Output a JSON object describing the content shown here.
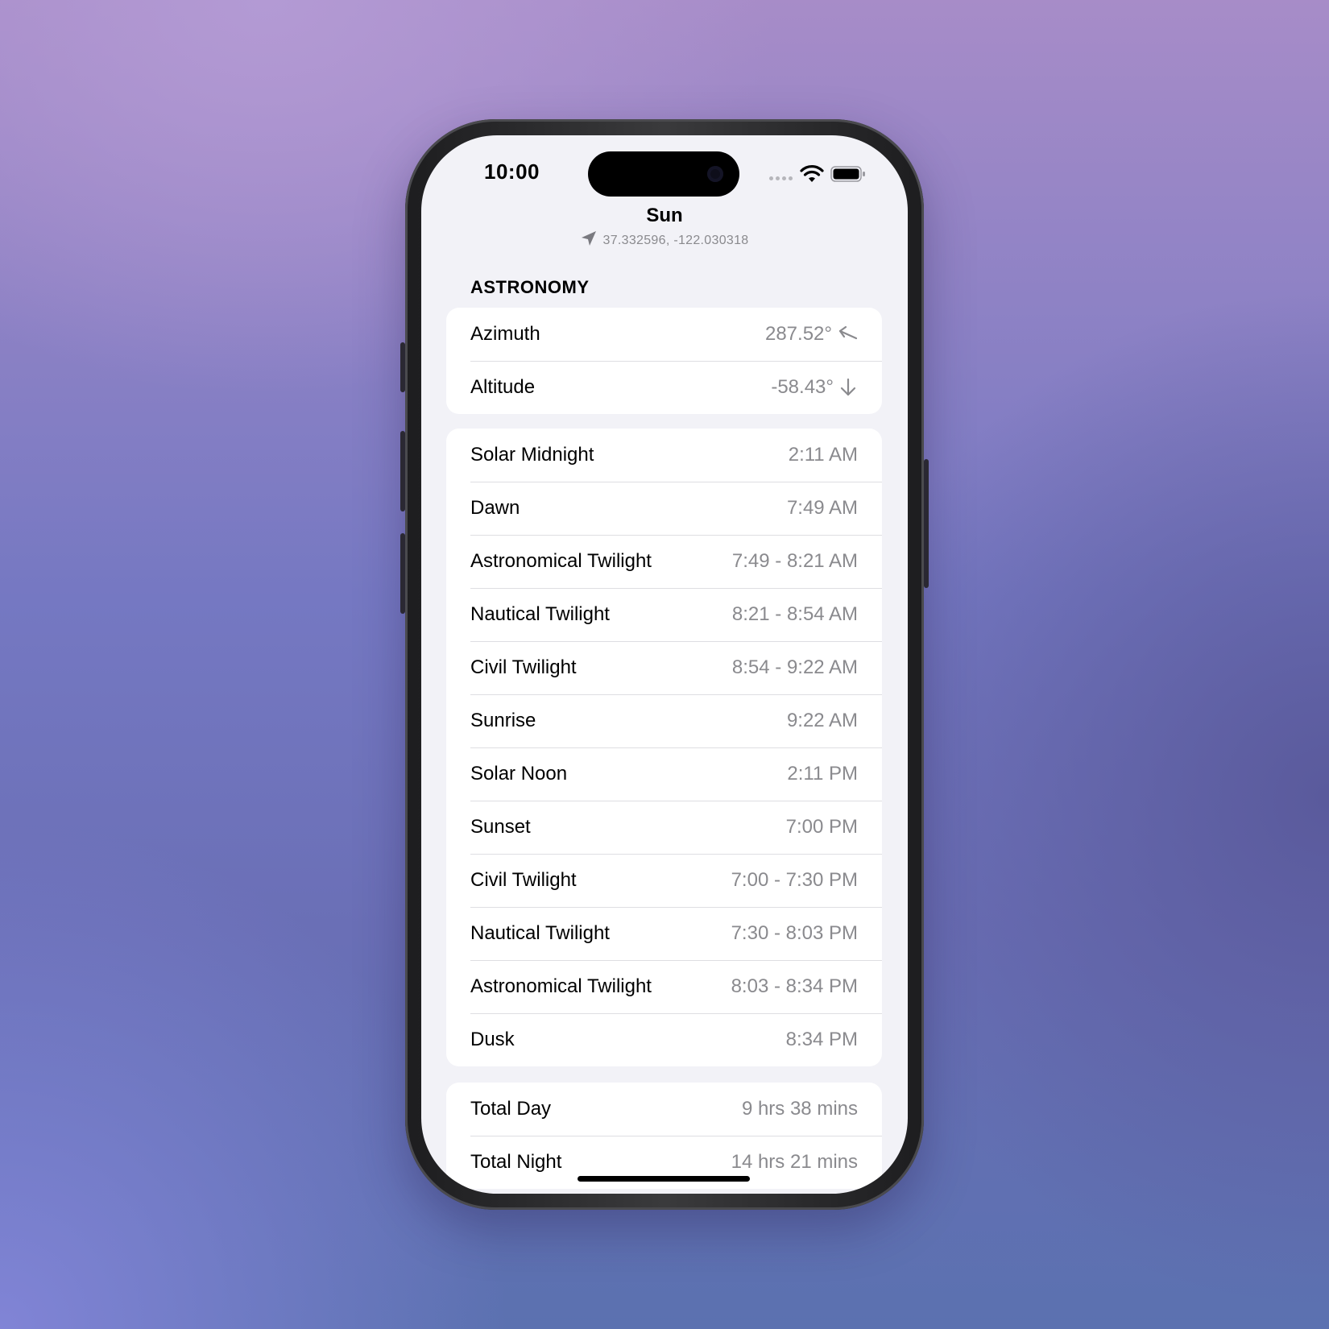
{
  "status_bar": {
    "time": "10:00"
  },
  "header": {
    "title": "Sun",
    "coordinates": "37.332596, -122.030318"
  },
  "section_title": "ASTRONOMY",
  "position_group": [
    {
      "label": "Azimuth",
      "value": "287.52°",
      "icon": "arrow-up-left-icon"
    },
    {
      "label": "Altitude",
      "value": "-58.43°",
      "icon": "arrow-down-icon"
    }
  ],
  "times_group": [
    {
      "label": "Solar Midnight",
      "value": "2:11 AM"
    },
    {
      "label": "Dawn",
      "value": "7:49 AM"
    },
    {
      "label": "Astronomical Twilight",
      "value": "7:49 - 8:21 AM"
    },
    {
      "label": "Nautical Twilight",
      "value": "8:21 - 8:54 AM"
    },
    {
      "label": "Civil Twilight",
      "value": "8:54 - 9:22 AM"
    },
    {
      "label": "Sunrise",
      "value": "9:22 AM"
    },
    {
      "label": "Solar Noon",
      "value": "2:11 PM"
    },
    {
      "label": "Sunset",
      "value": "7:00 PM"
    },
    {
      "label": "Civil Twilight",
      "value": "7:00 - 7:30 PM"
    },
    {
      "label": "Nautical Twilight",
      "value": "7:30 - 8:03 PM"
    },
    {
      "label": "Astronomical Twilight",
      "value": "8:03 - 8:34 PM"
    },
    {
      "label": "Dusk",
      "value": "8:34 PM"
    }
  ],
  "totals_group": [
    {
      "label": "Total Day",
      "value": "9 hrs 38 mins"
    },
    {
      "label": "Total Night",
      "value": "14 hrs 21 mins"
    }
  ],
  "colors": {
    "screen_background": "#f2f2f7",
    "card": "#ffffff",
    "secondary_text": "#8a8a8e",
    "separator": "#dedee2"
  }
}
